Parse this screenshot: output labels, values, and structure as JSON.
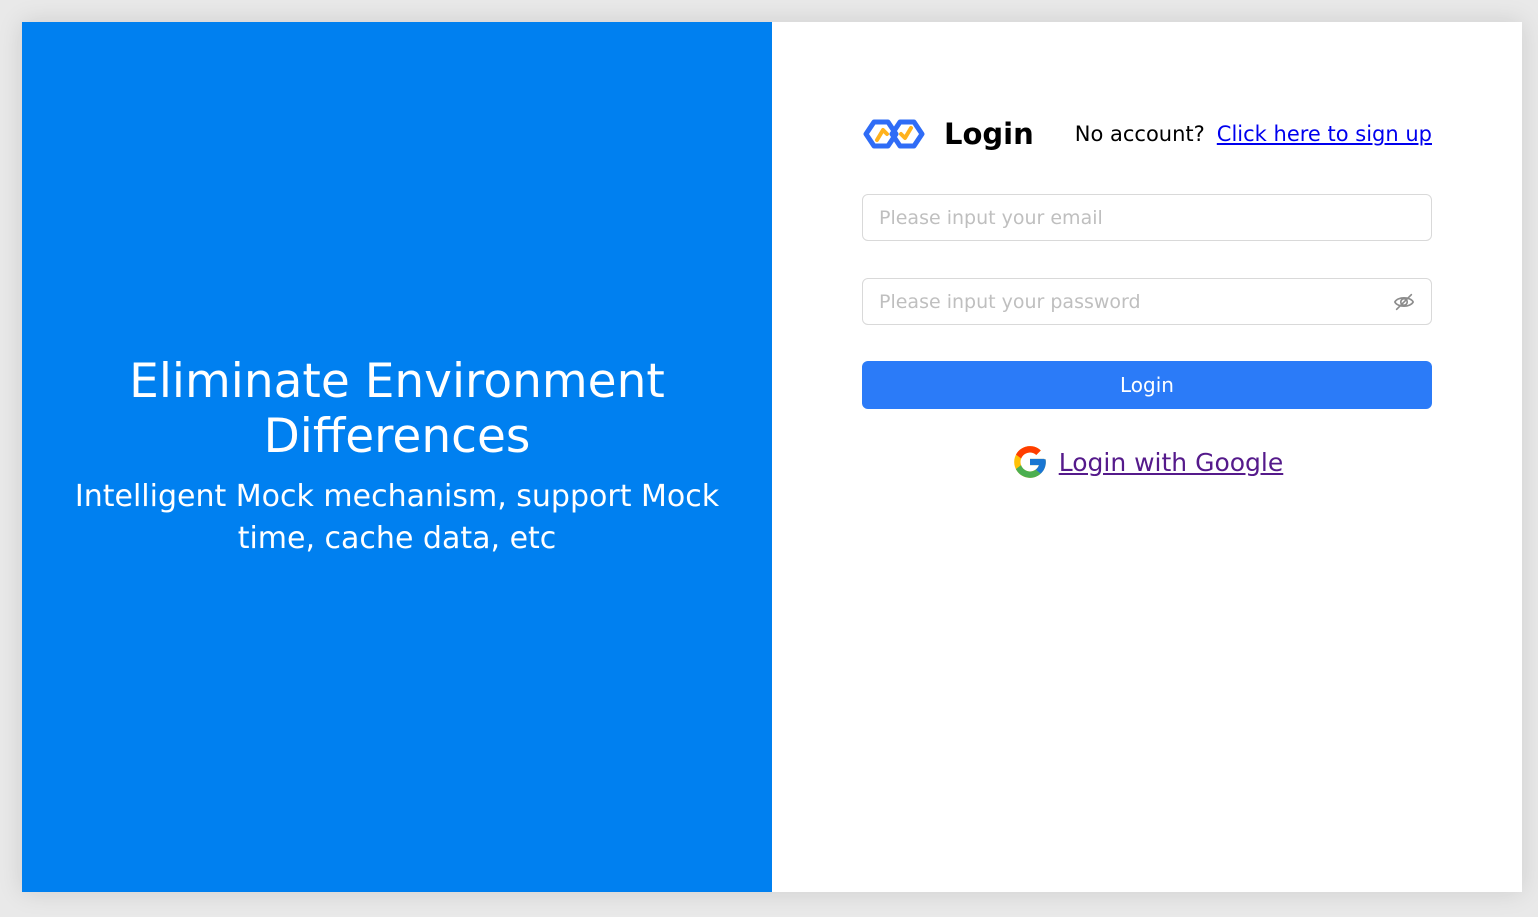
{
  "hero": {
    "title": "Eliminate Environment Differences",
    "subtitle": "Intelligent Mock mechanism, support Mock time, cache data, etc"
  },
  "login": {
    "title": "Login",
    "no_account_text": "No account?",
    "signup_link": "Click here to sign up",
    "email_placeholder": "Please input your email",
    "password_placeholder": "Please input your password",
    "login_button": "Login",
    "google_link": "Login with Google"
  },
  "icons": {
    "logo": "app-logo-icon",
    "password_visibility": "eye-slash-icon",
    "google": "google-icon"
  },
  "colors": {
    "hero_background": "#0080f0",
    "primary_button": "#2b7bf8",
    "signup_link": "#0000ee",
    "google_link": "#551a8b",
    "placeholder": "#bfbfbf"
  }
}
